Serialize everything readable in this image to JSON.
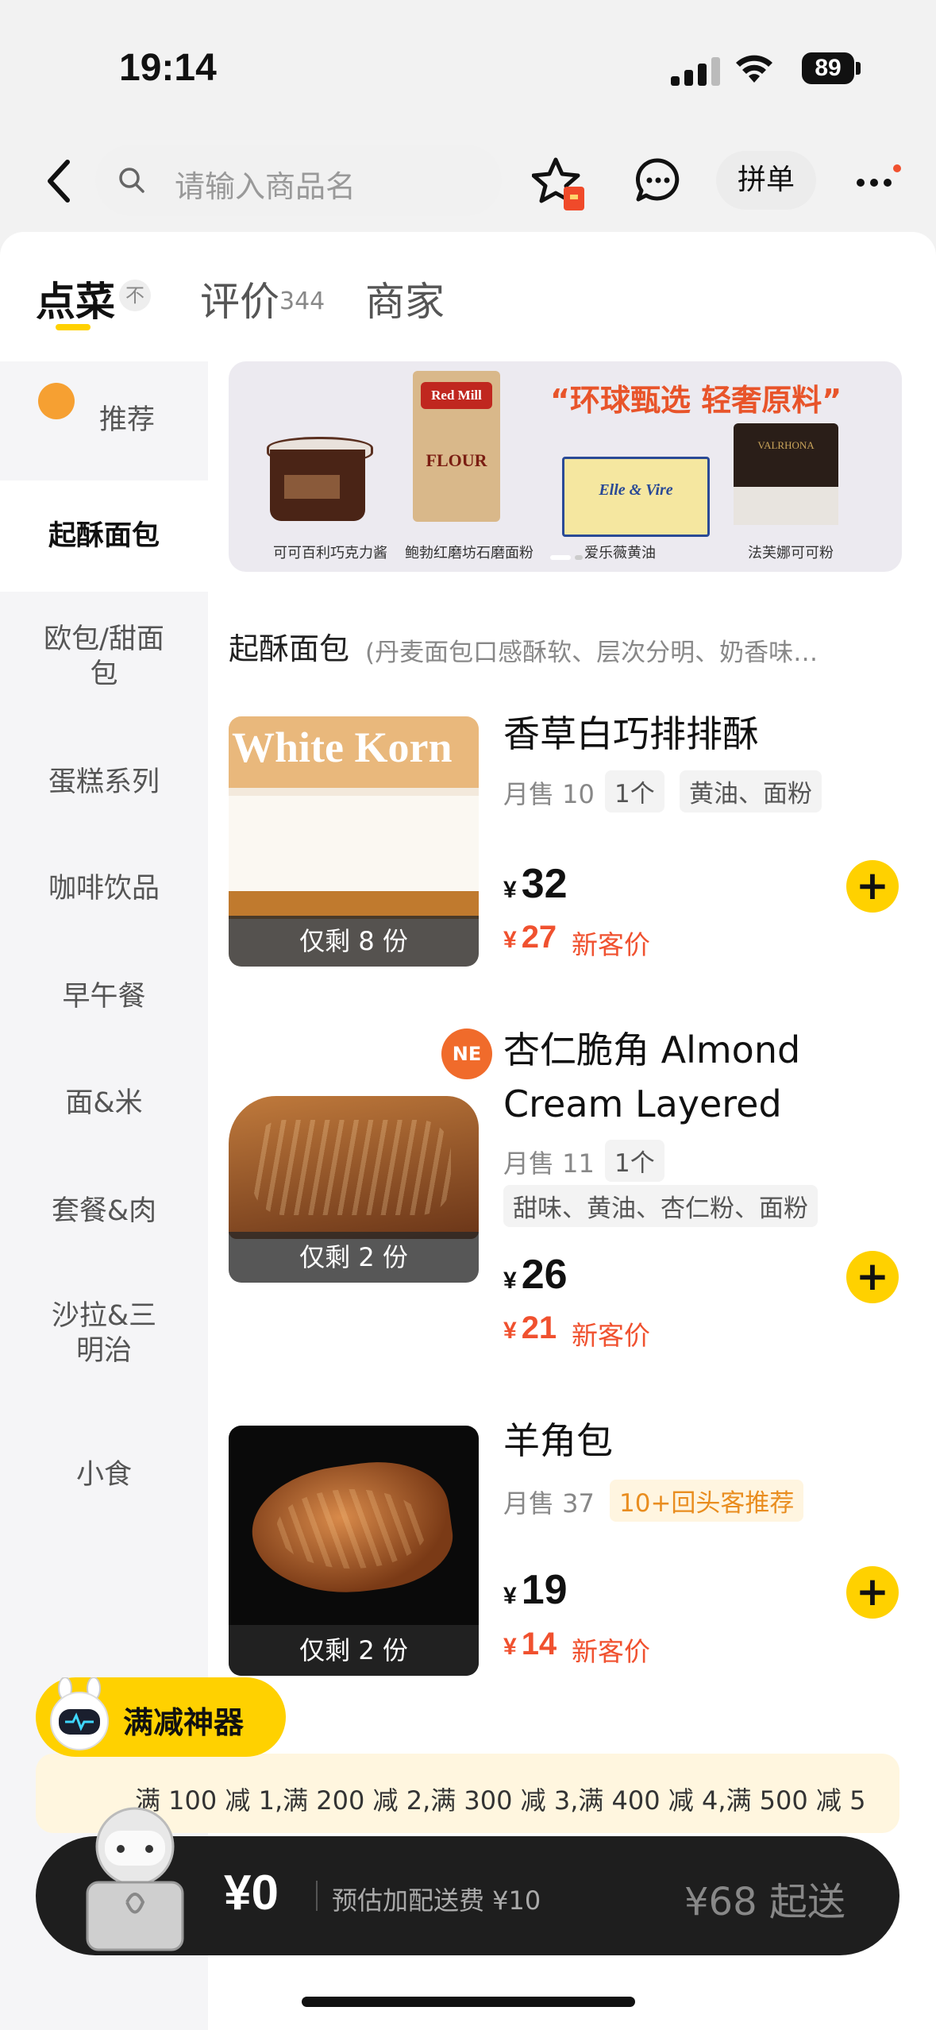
{
  "status_bar": {
    "time": "19:14",
    "battery": "89"
  },
  "nav": {
    "search_placeholder": "请输入商品名",
    "pindan_label": "拼单"
  },
  "tabs": [
    {
      "label": "点菜",
      "active": true
    },
    {
      "label": "评价",
      "count": "344"
    },
    {
      "label": "商家"
    }
  ],
  "tab_badge": "不",
  "sidebar": {
    "items": [
      {
        "label": "推荐"
      },
      {
        "label": "起酥面包",
        "active": true
      },
      {
        "label": "欧包/甜面\n包"
      },
      {
        "label": "蛋糕系列"
      },
      {
        "label": "咖啡饮品"
      },
      {
        "label": "早午餐"
      },
      {
        "label": "面&米"
      },
      {
        "label": "套餐&肉"
      },
      {
        "label": "沙拉&三\n明治"
      },
      {
        "label": "小食"
      }
    ]
  },
  "banner": {
    "title": "“环球甄选 轻奢原料”",
    "products": [
      "可可百利巧克力酱",
      "鲍勃红磨坊石磨面粉",
      "爱乐薇黄油",
      "法芙娜可可粉"
    ],
    "flour_text": "FLOUR",
    "flour_brand": "Red Mill",
    "butter_text": "Elle & Vire",
    "cocoa_text": "VALRHONA"
  },
  "section": {
    "title": "起酥面包",
    "desc": "(丹麦面包口感酥软、层次分明、奶香味…"
  },
  "products": [
    {
      "name": "香草白巧排排酥",
      "monthly": "月售 10",
      "tags": [
        "1个",
        "黄油、面粉"
      ],
      "price": "32",
      "new_price": "27",
      "new_label": "新客价",
      "stock": "仅剩 8 份",
      "image_text": "White Korn"
    },
    {
      "name": "杏仁脆角 Almond Cream Layered",
      "monthly": "月售 11",
      "tags": [
        "1个",
        "甜味、黄油、杏仁粉、面粉"
      ],
      "price": "26",
      "new_price": "21",
      "new_label": "新客价",
      "stock": "仅剩 2 份",
      "badge": "NE"
    },
    {
      "name": "羊角包",
      "monthly": "月售 37",
      "tags": [
        "10+回头客推荐"
      ],
      "price": "19",
      "new_price": "14",
      "new_label": "新客价",
      "stock": "仅剩 2 份"
    }
  ],
  "currency": "¥",
  "promo": {
    "tool_label": "满减神器",
    "text": "满 100 减 1,满 200 减 2,满 300 减 3,满 400 减 4,满 500 减 5"
  },
  "cart": {
    "amount": "¥0",
    "fee": "预估加配送费 ¥10",
    "min_order": "¥68 起送"
  },
  "colors": {
    "accent": "#ffd100",
    "price_red": "#f0512f",
    "cart_bg": "#1e1e1e"
  }
}
